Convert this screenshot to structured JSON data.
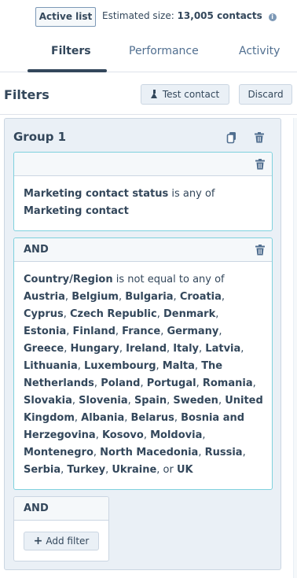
{
  "header": {
    "badge": "Active list",
    "estimated_label": "Estimated size:",
    "estimated_value": "13,005 contacts"
  },
  "tabs": [
    {
      "label": "Filters",
      "active": true
    },
    {
      "label": "Performance",
      "active": false
    },
    {
      "label": "Activity",
      "active": false
    }
  ],
  "filters_panel": {
    "title": "Filters",
    "test_contact_label": "Test contact",
    "discard_label": "Discard"
  },
  "group": {
    "title": "Group 1",
    "filters": [
      {
        "connector": "",
        "property": "Marketing contact status",
        "operator": "is any of",
        "values": [
          "Marketing contact"
        ]
      },
      {
        "connector": "AND",
        "property": "Country/Region",
        "operator": "is not equal to any of",
        "values": [
          "Austria",
          "Belgium",
          "Bulgaria",
          "Croatia",
          "Cyprus",
          "Czech Republic",
          "Denmark",
          "Estonia",
          "Finland",
          "France",
          "Germany",
          "Greece",
          "Hungary",
          "Ireland",
          "Italy",
          "Latvia",
          "Lithuania",
          "Luxembourg",
          "Malta",
          "The Netherlands",
          "Poland",
          "Portugal",
          "Romania",
          "Slovakia",
          "Slovenia",
          "Spain",
          "Sweden",
          "United Kingdom",
          "Albania",
          "Belarus",
          "Bosnia and Herzegovina",
          "Kosovo",
          "Moldovia",
          "Montenegro",
          "North Macedonia",
          "Russia",
          "Serbia",
          "Turkey",
          "Ukraine",
          "UK"
        ],
        "final_joiner": "or"
      }
    ],
    "add_block": {
      "connector": "AND",
      "add_filter_label": "Add filter"
    }
  },
  "icons": {
    "info": "info-icon",
    "test_contact": "flask-icon",
    "clone": "clone-icon",
    "delete": "trash-icon",
    "add": "plus-icon"
  },
  "colors": {
    "text": "#33475b",
    "group_bg": "#eaf0f6",
    "card_border_active": "#7fd1de",
    "card_border": "#cbd6e2"
  }
}
